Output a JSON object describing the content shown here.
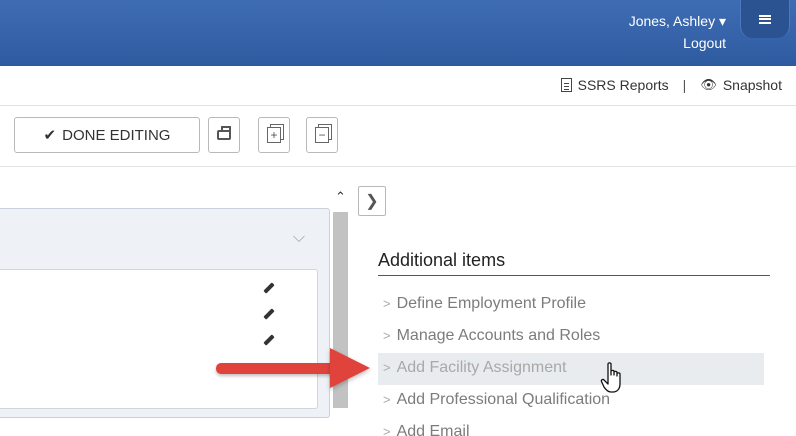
{
  "header": {
    "user_name": "Jones, Ashley ▾",
    "logout": "Logout",
    "menu_icon": "hamburger-icon"
  },
  "subbar": {
    "reports_label": "SSRS Reports",
    "separator": "|",
    "snapshot_label": "Snapshot",
    "reports_icon": "document-icon",
    "snapshot_icon": "eye-icon"
  },
  "toolbar": {
    "done_label": "DONE EDITING",
    "done_icon": "checkmark-icon",
    "print_icon": "print-icon",
    "expand_icon": "expand-all-icon",
    "collapse_icon": "collapse-all-icon"
  },
  "panel": {
    "chevron_icon": "chevron-down-icon",
    "edit_icons": [
      "pencil-icon",
      "pencil-icon",
      "pencil-icon"
    ]
  },
  "sidebar": {
    "toggle_icon": "chevron-right-icon",
    "heading": "Additional items",
    "items": [
      {
        "label": "Define Employment Profile"
      },
      {
        "label": "Manage Accounts and Roles"
      },
      {
        "label": "Add Facility Assignment"
      },
      {
        "label": "Add Professional Qualification"
      },
      {
        "label": "Add Email"
      }
    ]
  },
  "colors": {
    "header_blue": "#3f6db3",
    "arrow_red": "#e0433c"
  }
}
